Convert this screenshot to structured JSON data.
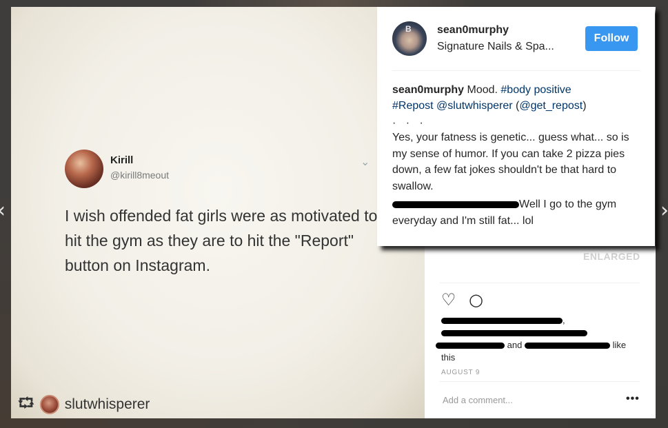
{
  "navigation": {
    "prev_icon": "chevron-left-icon",
    "prev_glyph": "‹",
    "next_icon": "chevron-right-icon",
    "next_glyph": "›"
  },
  "tweet": {
    "name": "Kirill",
    "handle": "@kirill8meout",
    "caret": "⌄",
    "text": "I wish offended fat girls were as motivated to hit the gym as they are to hit the \"Report\" button on Instagram."
  },
  "repost_bar": {
    "icon": "repost-icon",
    "glyph": "⮔",
    "username": "slutwhisperer"
  },
  "post_header": {
    "username": "sean0murphy",
    "location": "Signature Nails & Spa...",
    "follow_label": "Follow",
    "avatar_cap_letter": "B"
  },
  "caption": {
    "author": "sean0murphy",
    "text_start": " Mood. ",
    "hashtag_1": "#body positive",
    "hashtag_2": "#Repost",
    "mention_1": "@slutwhisperer",
    "mention_2_open": " (",
    "mention_2": "@get_repost",
    "mention_2_close": ")",
    "more_dots": "· · ·",
    "body": "Yes, your fatness is genetic... guess what... so is my sense of humor. If you can take 2 pizza pies down, a few fat jokes shouldn't be that hard to swallow."
  },
  "comment": {
    "text": "Well I go to the gym everyday and I'm still fat... lol"
  },
  "side_panel": {
    "enlarged_label": "ENLARGED",
    "like_icon": "heart-icon",
    "like_glyph": "♡",
    "comment_icon": "comment-icon",
    "comment_glyph": "○",
    "likes_tail_1": ",",
    "likes_and": "and",
    "likes_like": "like",
    "likes_this": "this",
    "date": "AUGUST 9",
    "comment_placeholder": "Add a comment...",
    "more_options": "•••"
  },
  "colors": {
    "follow_button": "#3897f0",
    "link": "#003569",
    "text": "#262626",
    "muted": "#999999"
  }
}
